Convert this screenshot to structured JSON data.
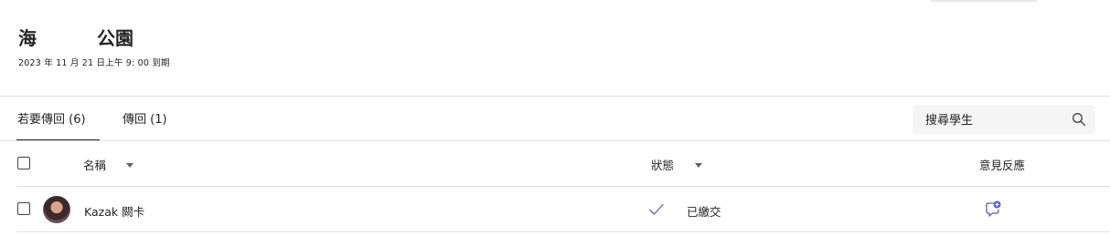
{
  "assignment": {
    "title_part1": "海",
    "title_part2": "公園",
    "due": "2023 年 11 月 21 日上午 9: 00 到期"
  },
  "tabs": [
    {
      "label": "若要傳回 (6)",
      "active": true
    },
    {
      "label": "傳回 (1)",
      "active": false
    }
  ],
  "search": {
    "placeholder": "搜尋學生",
    "icon": "search-icon"
  },
  "columns": {
    "name": "名稱",
    "status": "狀態",
    "feedback": "意見反應"
  },
  "students": [
    {
      "name": "Kazak 闕卡",
      "status": "已繳交",
      "status_icon": "checkmark-icon",
      "feedback_icon": "comment-add-icon"
    }
  ],
  "colors": {
    "accent": "#5b5fc7",
    "text": "#242424",
    "divider": "#e1e1e1",
    "search_bg": "#f5f5f5"
  }
}
